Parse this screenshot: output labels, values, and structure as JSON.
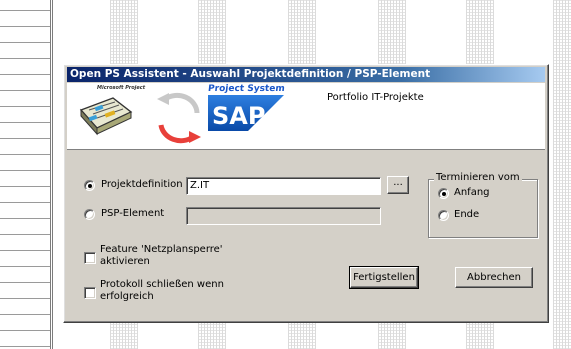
{
  "dialog": {
    "title": "Open PS Assistent - Auswahl Projektdefinition / PSP-Element",
    "header": {
      "ms_project_label": "Microsoft Project",
      "project_system_label": "Project System",
      "sap_label": "SAP",
      "portfolio_text": "Portfolio IT-Projekte"
    },
    "projektdefinition": {
      "label": "Projektdefinition",
      "selected": true,
      "value": "Z.IT",
      "browse_label": "..."
    },
    "psp_element": {
      "label": "PSP-Element",
      "selected": false,
      "value": ""
    },
    "terminieren": {
      "legend": "Terminieren vom",
      "options": [
        {
          "label": "Anfang",
          "selected": true
        },
        {
          "label": "Ende",
          "selected": false
        }
      ]
    },
    "checkbox_feature": {
      "line1": "Feature 'Netzplansperre'",
      "line2": "aktivieren",
      "checked": false
    },
    "checkbox_protokoll": {
      "line1": "Protokoll schließen wenn",
      "line2": "erfolgreich",
      "checked": false
    },
    "buttons": {
      "finish": "Fertigstellen",
      "cancel": "Abbrechen"
    }
  },
  "colors": {
    "dialog_bg": "#d4d0c8",
    "titlebar_start": "#0a246a",
    "titlebar_end": "#a6caf0",
    "sap_blue": "#1a57c9"
  }
}
